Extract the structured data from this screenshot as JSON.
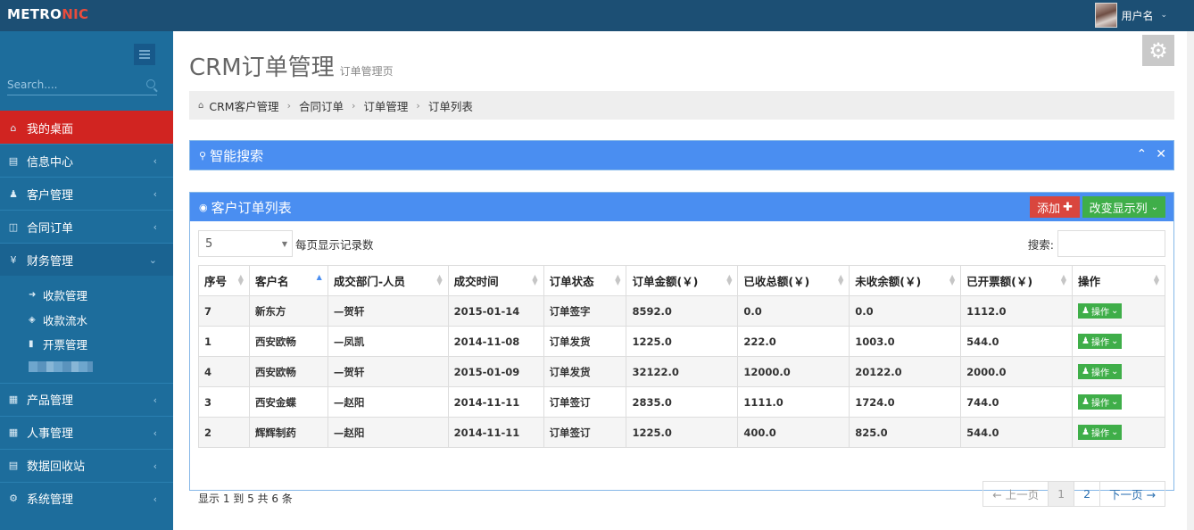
{
  "header": {
    "logo_main": "METRO",
    "logo_accent": "NIC",
    "username": "用户名"
  },
  "sidebar": {
    "search_placeholder": "Search....",
    "items": [
      {
        "label": "我的桌面",
        "icon": "home-icon"
      },
      {
        "label": "信息中心",
        "icon": "calendar-icon"
      },
      {
        "label": "客户管理",
        "icon": "user-icon"
      },
      {
        "label": "合同订单",
        "icon": "book-icon"
      },
      {
        "label": "财务管理",
        "icon": "yen-icon"
      },
      {
        "label": "产品管理",
        "icon": "table-icon"
      },
      {
        "label": "人事管理",
        "icon": "table-icon"
      },
      {
        "label": "数据回收站",
        "icon": "trash-icon"
      },
      {
        "label": "系统管理",
        "icon": "gear-icon"
      }
    ],
    "finance_sub": [
      {
        "label": "收款管理",
        "icon": "sign-in-icon"
      },
      {
        "label": "收款流水",
        "icon": "tint-icon"
      },
      {
        "label": "开票管理",
        "icon": "barcode-icon"
      }
    ]
  },
  "page": {
    "title": "CRM订单管理",
    "subtitle": "订单管理页",
    "breadcrumb": [
      "CRM客户管理",
      "合同订单",
      "订单管理",
      "订单列表"
    ]
  },
  "search_panel": {
    "title": "智能搜索"
  },
  "list_panel": {
    "title": "客户订单列表",
    "add_label": "添加",
    "columns_label": "改变显示列",
    "page_length": "5",
    "page_length_label": "每页显示记录数",
    "search_label": "搜索:",
    "headers": [
      "序号",
      "客户名",
      "成交部门-人员",
      "成交时间",
      "订单状态",
      "订单金额(￥)",
      "已收总额(￥)",
      "未收余额(￥)",
      "已开票额(￥)",
      "操作"
    ],
    "rows": [
      [
        "7",
        "新东方",
        "—贺轩",
        "2015-01-14",
        "订单签字",
        "8592.0",
        "0.0",
        "0.0",
        "1112.0"
      ],
      [
        "1",
        "西安欧畅",
        "—凤凯",
        "2014-11-08",
        "订单发货",
        "1225.0",
        "222.0",
        "1003.0",
        "544.0"
      ],
      [
        "4",
        "西安欧畅",
        "—贺轩",
        "2015-01-09",
        "订单发货",
        "32122.0",
        "12000.0",
        "20122.0",
        "2000.0"
      ],
      [
        "3",
        "西安金蝶",
        "—赵阳",
        "2014-11-11",
        "订单签订",
        "2835.0",
        "1111.0",
        "1724.0",
        "744.0"
      ],
      [
        "2",
        "辉辉制药",
        "—赵阳",
        "2014-11-11",
        "订单签订",
        "1225.0",
        "400.0",
        "825.0",
        "544.0"
      ]
    ],
    "op_label": "操作",
    "info": "显示 1 到 5 共 6 条",
    "pager": {
      "prev": "← 上一页",
      "pages": [
        "1",
        "2"
      ],
      "next": "下一页 →"
    }
  }
}
